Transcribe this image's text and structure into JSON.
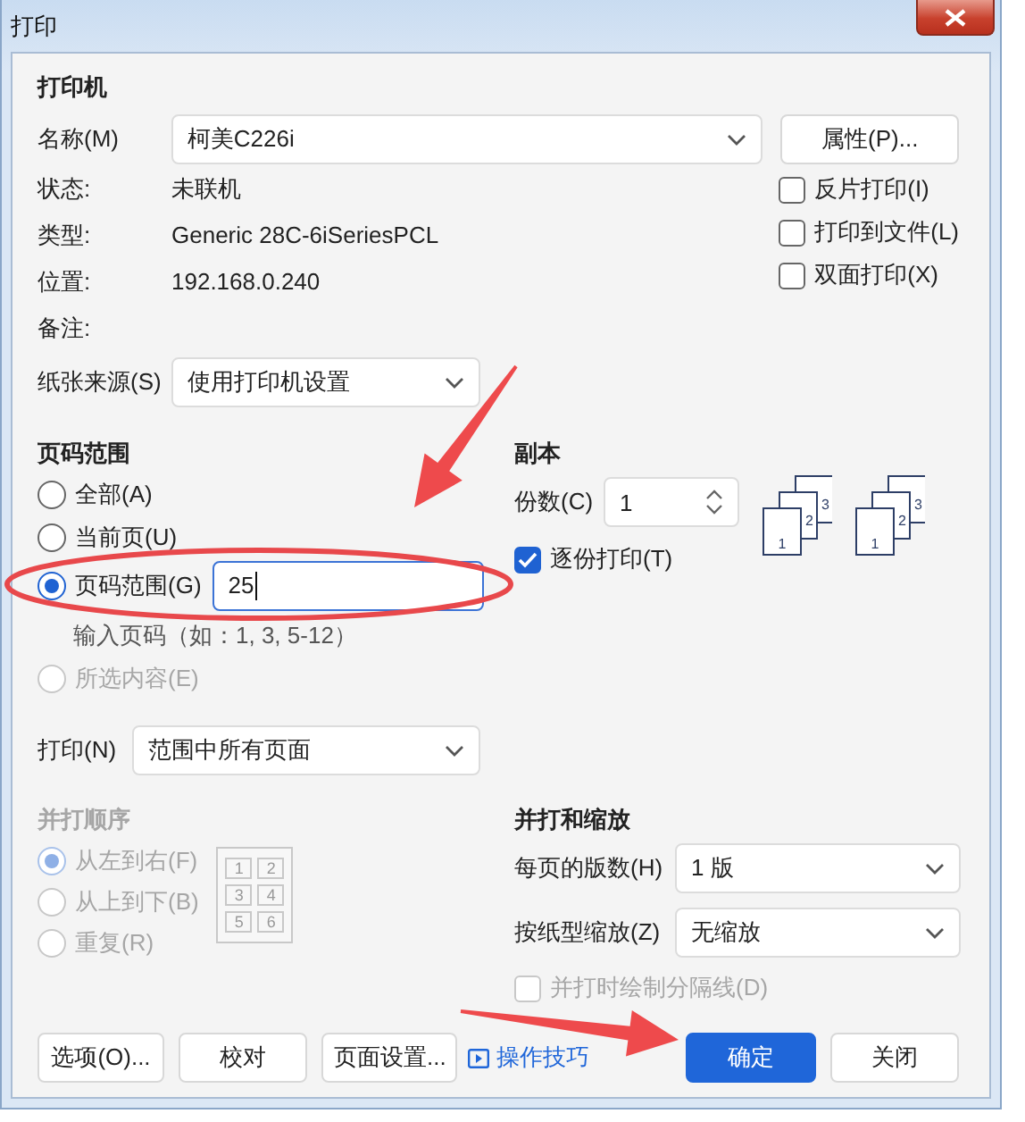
{
  "window": {
    "title": "打印"
  },
  "printer": {
    "heading": "打印机",
    "name_label": "名称(M)",
    "name_value": "柯美C226i",
    "properties_button": "属性(P)...",
    "info": [
      {
        "label": "状态:",
        "value": "未联机"
      },
      {
        "label": "类型:",
        "value": "Generic 28C-6iSeriesPCL"
      },
      {
        "label": "位置:",
        "value": "192.168.0.240"
      },
      {
        "label": "备注:"
      }
    ],
    "options": [
      {
        "label": "反片打印(I)",
        "checked": false
      },
      {
        "label": "打印到文件(L)",
        "checked": false
      },
      {
        "label": "双面打印(X)",
        "checked": false
      }
    ],
    "paper_source": {
      "label": "纸张来源(S)",
      "value": "使用打印机设置"
    }
  },
  "page_range": {
    "heading": "页码范围",
    "options": [
      {
        "label": "全部(A)",
        "selected": false,
        "disabled": false
      },
      {
        "label": "当前页(U)",
        "selected": false,
        "disabled": false
      },
      {
        "label": "页码范围(G)",
        "selected": true,
        "disabled": false,
        "value": "25",
        "hint": "输入页码（如：1, 3, 5-12）"
      },
      {
        "label": "所选内容(E)",
        "selected": false,
        "disabled": true
      }
    ]
  },
  "print_subset": {
    "label": "打印(N)",
    "value": "范围中所有页面"
  },
  "copies": {
    "heading": "副本",
    "count_label": "份数(C)",
    "count_value": "1",
    "collate": {
      "label": "逐份打印(T)",
      "checked": true
    },
    "preview": [
      {
        "pages": [
          "1",
          "2",
          "3"
        ]
      },
      {
        "pages": [
          "1",
          "2",
          "3"
        ]
      }
    ]
  },
  "order": {
    "heading": "并打顺序",
    "disabled": true,
    "options": [
      {
        "label": "从左到右(F)",
        "selected": true
      },
      {
        "label": "从上到下(B)",
        "selected": false
      },
      {
        "label": "重复(R)",
        "selected": false
      }
    ],
    "preview": [
      "1",
      "2",
      "3",
      "4",
      "5",
      "6"
    ]
  },
  "scaling": {
    "heading": "并打和缩放",
    "per_page_label": "每页的版数(H)",
    "per_page_value": "1 版",
    "scale_label": "按纸型缩放(Z)",
    "scale_value": "无缩放",
    "draw_borders": {
      "label": "并打时绘制分隔线(D)",
      "checked": false,
      "disabled": true
    }
  },
  "buttons": [
    {
      "label": "选项(O)...",
      "kind": "button"
    },
    {
      "label": "校对",
      "kind": "button"
    },
    {
      "label": "页面设置...",
      "kind": "button"
    },
    {
      "label": "操作技巧",
      "kind": "link"
    },
    {
      "label": "确定",
      "kind": "primary"
    },
    {
      "label": "关闭",
      "kind": "button"
    }
  ]
}
